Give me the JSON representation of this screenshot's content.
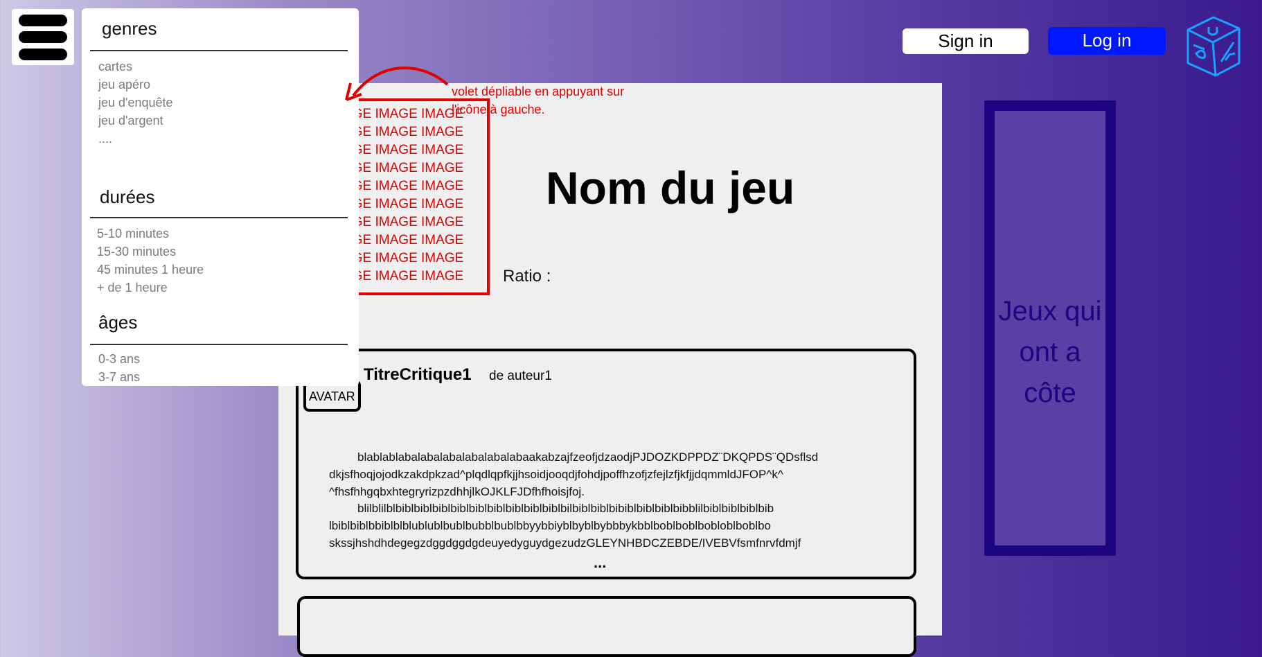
{
  "header": {
    "signin_label": "Sign in",
    "login_label": "Log in",
    "logo_icon": "dice-icon",
    "menu_icon": "hamburger-menu-icon"
  },
  "sidebar": {
    "sections": [
      {
        "title": "genres",
        "items": [
          "cartes",
          "jeu apéro",
          "jeu d'enquête",
          "jeu d'argent",
          "...."
        ]
      },
      {
        "title": "durées",
        "items": [
          "5-10 minutes",
          "15-30 minutes",
          "45 minutes 1 heure",
          "+ de 1 heure"
        ]
      },
      {
        "title": "âges",
        "items": [
          "0-3 ans",
          "3-7 ans"
        ]
      }
    ]
  },
  "annotation": {
    "text": "volet dépliable en appuyant sur l'icône à gauche."
  },
  "game": {
    "image_placeholder_line": "IMAGE IMAGE IMAGE",
    "title": "Nom du jeu",
    "ratio_label": "Ratio :"
  },
  "review": {
    "avatar_label": "AVATAR",
    "title": "TitreCritique1",
    "author": "de auteur1",
    "lines": [
      "blablablabalabalabalabalabalabaakabzajfzeofjdzaodjPJDOZKDPPDZ¨DKQPDS¨QDsflsd",
      "dkjsfhoqjojodkzakdpkzad^plqdlqpfkjjhsoidjooqdjfohdjpoffhzofjzfejlzfjkfjjdqmmldJFOP^k^",
      "^fhsfhhgqbxhtegryrizpzdhhjlkOJKLFJDfhfhoisjfoj.",
      "blilblilblbiblbiblbiblbiblbiblbiblbiblbiblbiblbilbiblbiblbibiblbiblbiblbibblilbiblbiblbiblbib",
      "lbiblbiblbbiblblblublublbublbubblbublbbyybbiyblbyblbybbbykbblboblboblbobloblboblbo",
      "skssjhshdhdegegzdggdggdgdeuyedyguydgezudzGLEYNHBDCZEBDE/IVEBVfsmfnrvfdmjf"
    ],
    "ellipsis": "..."
  },
  "related": {
    "line1": "Jeux qui",
    "line2": "ont a côte"
  },
  "colors": {
    "accent_blue": "#0018ff",
    "annotation_red": "#e00000",
    "related_border": "#1c0580"
  }
}
